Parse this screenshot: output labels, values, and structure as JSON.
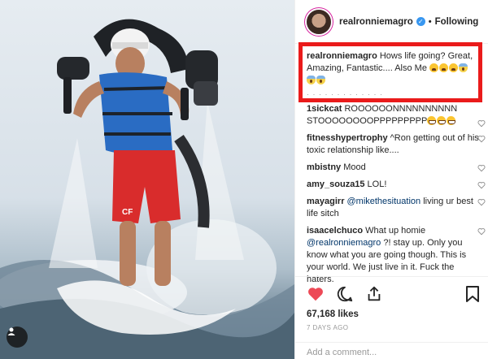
{
  "post": {
    "username": "realronniemagro",
    "separator": "•",
    "follow_label": "Following",
    "caption": {
      "username": "realronniemagro",
      "text": "Hows life going? Great, Amazing, Fantastic.... Also Me",
      "emojis": [
        "weary",
        "weary",
        "weary",
        "scream",
        "scream",
        "scream"
      ]
    },
    "caption_overflow": "· · · · · · · · · · · · ·",
    "comments": [
      {
        "username": "1sickcat",
        "text": "ROOOOOONNNNNNNNNN STOOOOOOOOPPPPPPPPP",
        "mention": "",
        "after": "",
        "emojis": [
          "grin",
          "grin",
          "grin"
        ]
      },
      {
        "username": "fitnesshypertrophy",
        "text": "^Ron getting out of his toxic relationship like....",
        "mention": "",
        "after": "",
        "emojis": []
      },
      {
        "username": "mbistny",
        "text": "Mood",
        "mention": "",
        "after": "",
        "emojis": []
      },
      {
        "username": "amy_souza15",
        "text": "LOL!",
        "mention": "",
        "after": "",
        "emojis": []
      },
      {
        "username": "mayagirr",
        "text": "",
        "mention": "@mikethesituation",
        "after": " living ur best life sitch",
        "emojis": []
      },
      {
        "username": "isaacelchuco",
        "text": "What up homie ",
        "mention": "@realronniemagro",
        "after": " ?! stay up. Only you know what you are going though. This is your world. We just live in it. Fuck the haters.",
        "emojis": []
      }
    ],
    "likes": "67,168 likes",
    "timestamp": "7 DAYS AGO",
    "comment_placeholder": "Add a comment..."
  },
  "colors": {
    "highlight": "#ea1b1b",
    "like_active": "#ed4956",
    "verified": "#3897f0",
    "mention": "#003569"
  },
  "icons": [
    "user-tag-icon",
    "verified-badge-icon",
    "heart-icon",
    "comment-icon",
    "share-icon",
    "bookmark-icon"
  ]
}
